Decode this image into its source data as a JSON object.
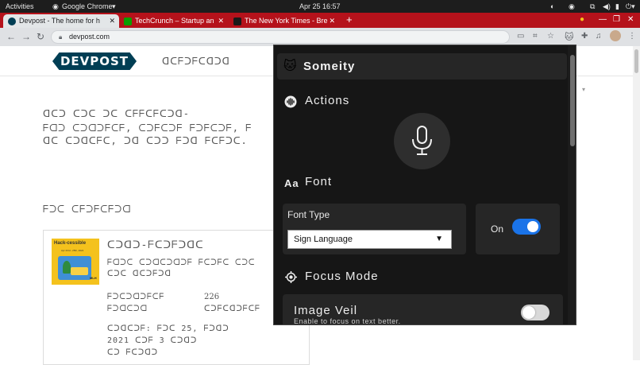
{
  "os_bar": {
    "activities": "Activities",
    "app_menu": "Google Chrome",
    "clock": "Apr 25  16:57"
  },
  "tabs": [
    {
      "title": "Devpost - The home for h",
      "active": true,
      "favicon_color": "#003e54"
    },
    {
      "title": "TechCrunch – Startup an",
      "active": false,
      "favicon_color": "#0a9e01"
    },
    {
      "title": "The New York Times - Bre",
      "active": false,
      "favicon_color": "#1a1a1a"
    }
  ],
  "new_tab": "+",
  "address_bar": {
    "url": "devpost.com"
  },
  "page": {
    "logo": "DEVPOST",
    "nav_text": "ᗡᑕᖴᑐᖴᑕᗡᑐᗡ",
    "intro_line1": "ᗡᑕᑐ ᑕᑐᑕ ᑐᑕ ᑕᖴᖴᑕᖴᑕᑐᗡ-",
    "intro_line2": "ᖴᗡᑐ ᑕᑐᗡᑐᖴᑕᖴ, ᑕᑐᖴᑕᑐᖴ ᖴᑐᖴᑕᑐᖴ, ᖴ",
    "intro_line3": "ᗡᑕ ᑕᑐᗡᑕᖴᑕ, ᑐᗡ ᑕᑐᑐ ᖴᑐᗡ ᖴᑕᖴᑐᑕ.",
    "section_heading": "ᖴᑐᑕ ᑕᖴᑐᖴᑕᖴᑐᗡ",
    "card": {
      "thumb_title": "Hack-cessible",
      "thumb_sub": "Apr 23rd - 25th, 2021",
      "thumb_badge": "MLH",
      "title": "ᑕᑐᗡᑐ-ᖴᑕᑐᖴᑐᗡᑕ",
      "desc_line1": "ᖴᗡᑐᑕ ᑕᑐᗡᑕᑐᗡᑐᖴ ᖴᑕᑐᖴᑕ ᑕᑐᑕ",
      "desc_line2": "ᑕᑐᑕ ᗡᑕᑐᖴᑐᗡ",
      "stat_label1": "ᖴᑐᑕᑐᗡᑐᖴᑕᖴ",
      "stat_label1b": "ᖴᑐᗡᑕᑐᗡ",
      "stat_value": "226",
      "stat_label2": "ᑕᑐᖴᑕᗡᑐᖴᑕᖴ",
      "deadline_line1": "ᑕᑐᗡᑕᑐᖴ: ᖴᑐᑕ 25, ᖴᑐᗡᑐ",
      "deadline_line2": "2021 ᑕᑐᖴ 3 ᑕᑐᗡᑐ",
      "deadline_line3": "ᑕᑐ ᖴᑕᑐᗡᑐ"
    }
  },
  "popup": {
    "app_name": "Someity",
    "actions_title": "Actions",
    "font_title": "Font",
    "font_icon_text": "Aa",
    "font_type_label": "Font Type",
    "font_type_value": "Sign Language",
    "on_label": "On",
    "focus_mode_title": "Focus Mode",
    "image_veil_title": "Image Veil",
    "image_veil_desc": "Enable to focus on text better."
  }
}
